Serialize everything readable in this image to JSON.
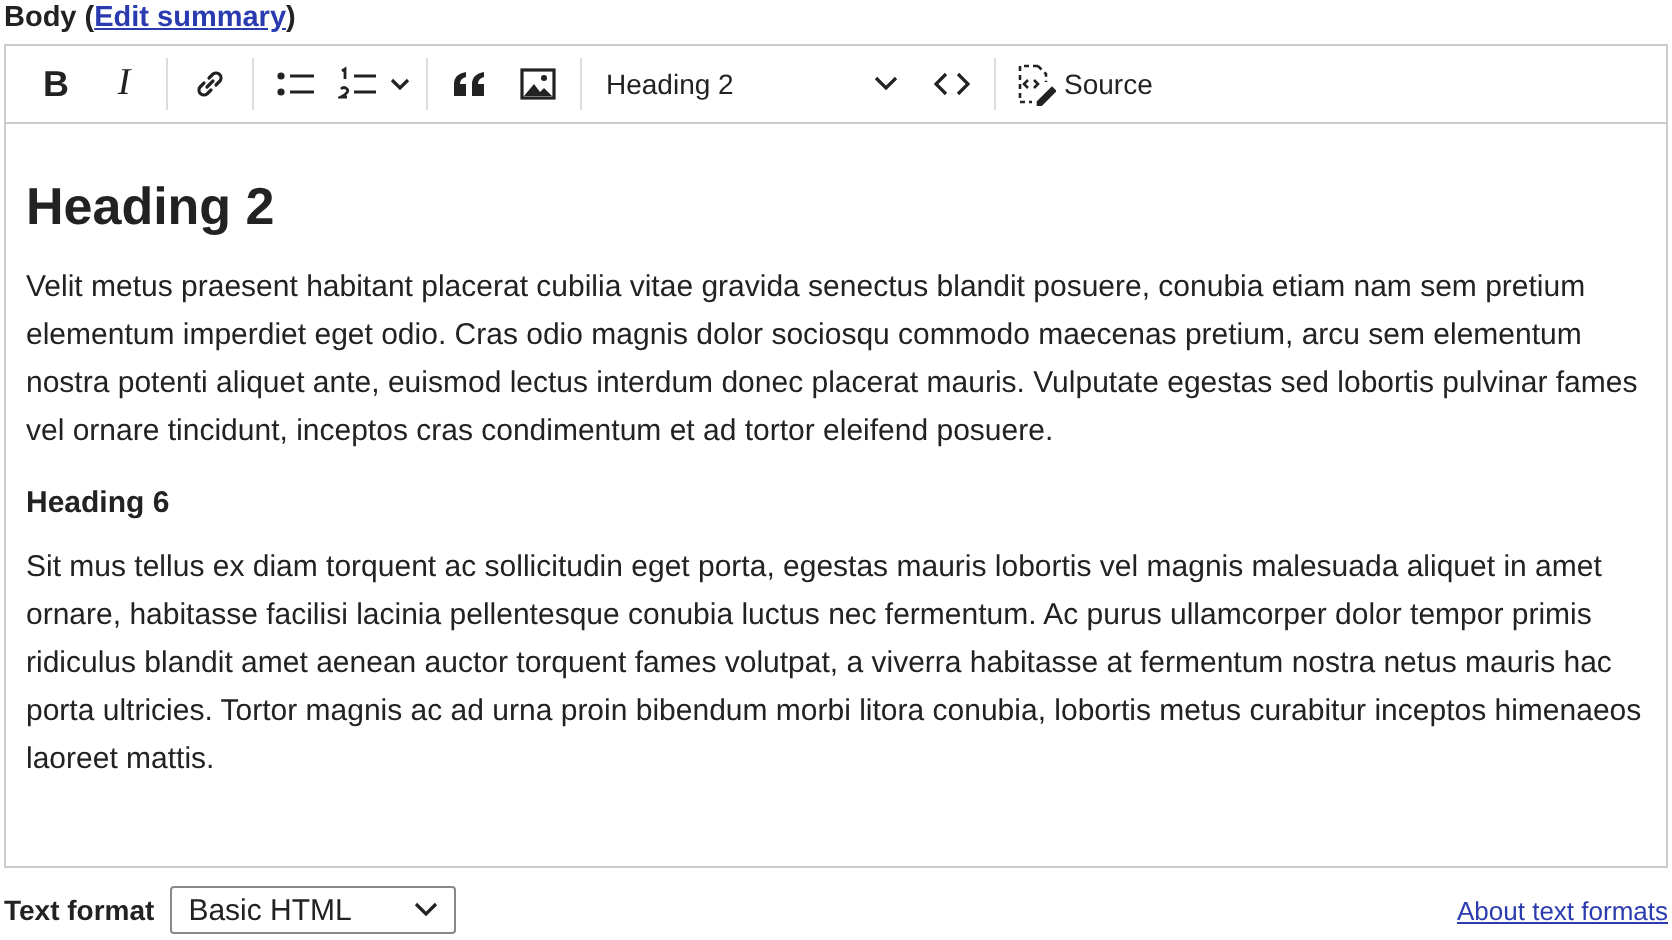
{
  "field": {
    "label": "Body (",
    "link": "Edit summary",
    "label_end": ")"
  },
  "toolbar": {
    "groups": [
      {
        "items": [
          {
            "kind": "bold",
            "text": "B"
          },
          {
            "kind": "italic",
            "text": "I"
          }
        ]
      },
      {
        "items": [
          {
            "kind": "link"
          }
        ]
      },
      {
        "items": [
          {
            "kind": "bulleted-list"
          },
          {
            "kind": "numbered-list"
          }
        ]
      },
      {
        "items": [
          {
            "kind": "blockquote"
          },
          {
            "kind": "image"
          }
        ]
      },
      {
        "items": [
          {
            "kind": "heading-select",
            "text": "Heading 2"
          },
          {
            "kind": "code"
          }
        ]
      },
      {
        "items": [
          {
            "kind": "source",
            "text": "Source"
          }
        ]
      }
    ]
  },
  "content": [
    {
      "kind": "heading-2",
      "text": "Heading 2"
    },
    {
      "kind": "paragraph",
      "text": "Velit metus praesent habitant placerat cubilia vitae gravida senectus blandit posuere, conubia etiam nam sem pretium elementum imperdiet eget odio. Cras odio magnis dolor sociosqu commodo maecenas pretium, arcu sem elementum nostra potenti aliquet ante, euismod lectus interdum donec placerat mauris. Vulputate egestas sed lobortis pulvinar fames vel ornare tincidunt, inceptos cras condimentum et ad tortor eleifend posuere."
    },
    {
      "kind": "heading-6",
      "text": "Heading 6"
    },
    {
      "kind": "paragraph",
      "text": "Sit mus tellus ex diam torquent ac sollicitudin eget porta, egestas mauris lobortis vel magnis malesuada aliquet in amet ornare, habitasse facilisi lacinia pellentesque conubia luctus nec fermentum. Ac purus ullamcorper dolor tempor primis ridiculus blandit amet aenean auctor torquent fames volutpat, a viverra habitasse at fermentum nostra netus mauris hac porta ultricies. Tortor magnis ac ad urna proin bibendum morbi litora conubia, lobortis metus curabitur inceptos himenaeos laoreet mattis."
    }
  ],
  "text_format": {
    "label": "Text format",
    "value": "Basic HTML",
    "help_link": "About text formats"
  }
}
